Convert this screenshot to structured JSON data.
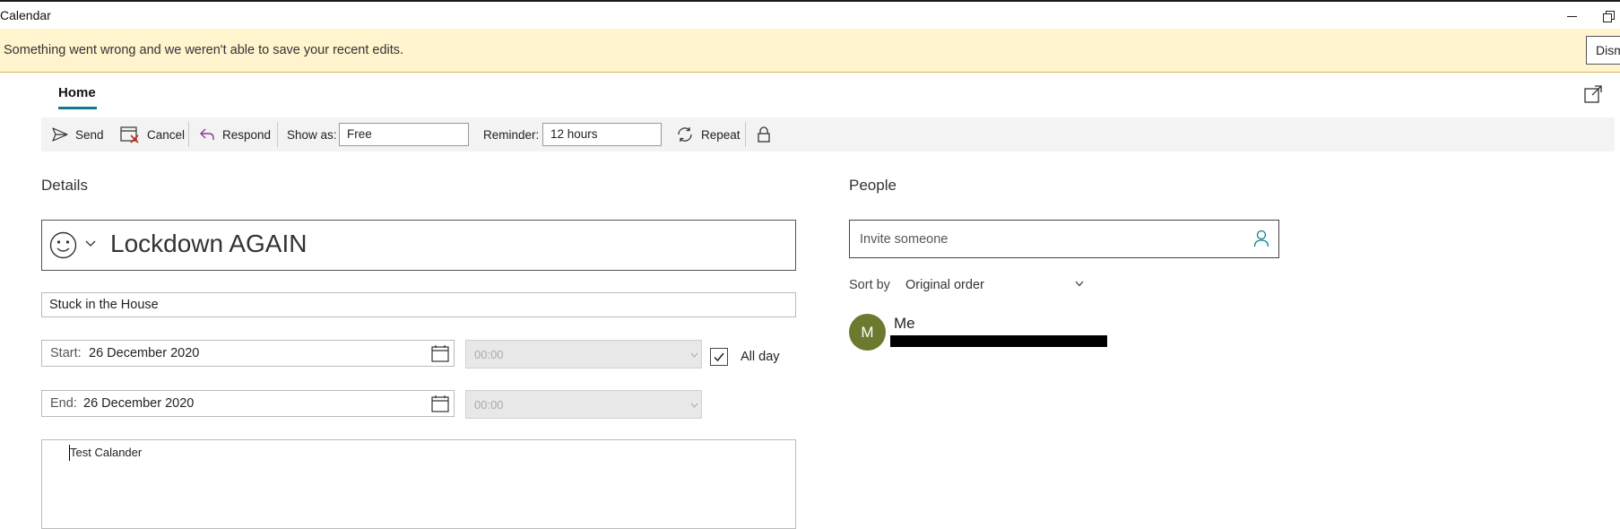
{
  "window": {
    "title": "Calendar"
  },
  "banner": {
    "message": "Something went wrong and we weren't able to save your recent edits.",
    "dismiss_label": "Dismiss"
  },
  "tabs": [
    {
      "label": "Home",
      "active": true
    }
  ],
  "toolbar": {
    "send_label": "Send",
    "cancel_label": "Cancel",
    "respond_label": "Respond",
    "show_as_label": "Show as:",
    "show_as_value": "Free",
    "reminder_label": "Reminder:",
    "reminder_value": "12 hours",
    "repeat_label": "Repeat"
  },
  "details": {
    "heading": "Details",
    "subject": "Lockdown AGAIN",
    "location": "Stuck in the House",
    "start_label": "Start:",
    "start_date": "26 December 2020",
    "start_time": "00:00",
    "end_label": "End:",
    "end_date": "26 December 2020",
    "end_time": "00:00",
    "all_day_label": "All day",
    "all_day_checked": true,
    "notes": "Test Calander"
  },
  "people": {
    "heading": "People",
    "invite_placeholder": "Invite someone",
    "sort_by_label": "Sort by",
    "sort_value": "Original order",
    "attendees": [
      {
        "initial": "M",
        "name": "Me",
        "avatar_color": "#6b7a2e"
      }
    ]
  },
  "colors": {
    "accent": "#0f7b8a",
    "banner_bg": "#fff4ce",
    "cancel_red": "#c42b1c",
    "respond_purple": "#8e3b9e"
  }
}
